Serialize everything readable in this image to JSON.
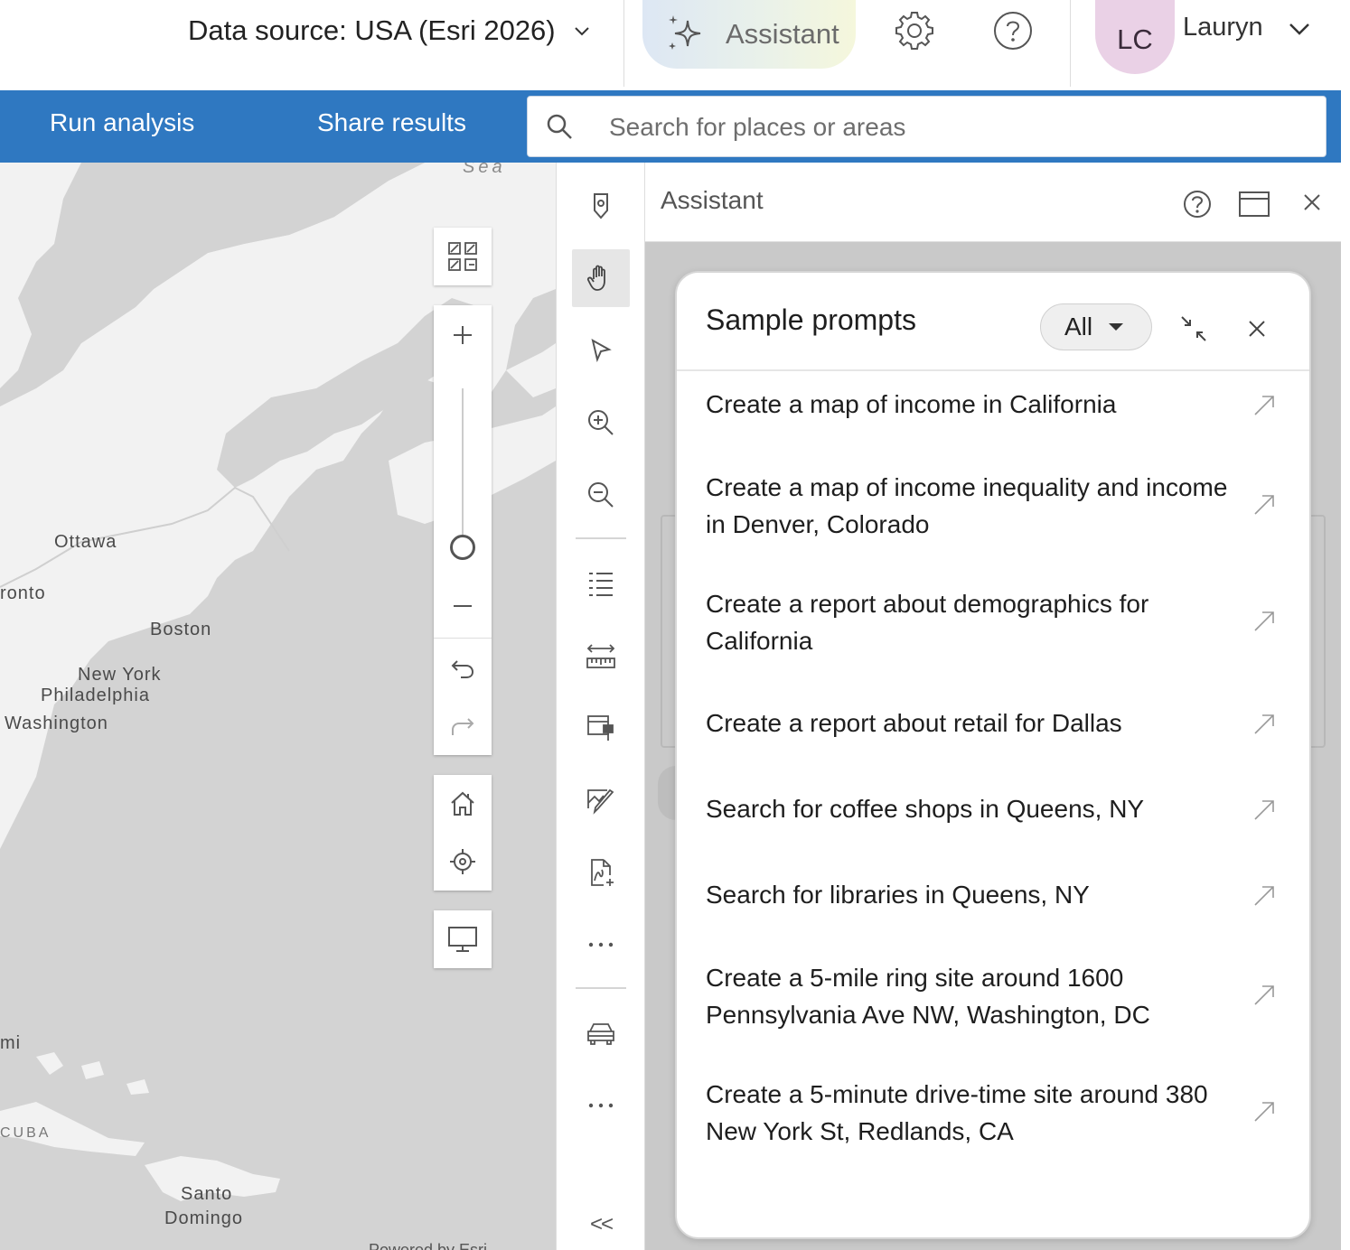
{
  "header": {
    "data_source_label": "Data source: USA (Esri 2026)",
    "assistant_label": "Assistant",
    "settings_icon": "gear-icon",
    "help_icon": "help-circle-icon",
    "user_initials": "LC",
    "user_name": "Lauryn",
    "avatar_color": "#ead1e6"
  },
  "actionbar": {
    "run_analysis": "Run analysis",
    "share_results": "Share results",
    "search_placeholder": "Search for places or areas",
    "search_value": "",
    "bar_color": "#2f78c1"
  },
  "map": {
    "places": {
      "sea": "Sea",
      "ottawa": "Ottawa",
      "toronto": "ronto",
      "boston": "Boston",
      "new_york": "New York",
      "philadelphia": "Philadelphia",
      "washington": "Washington",
      "miami": "mi",
      "cuba": "CUBA",
      "santo": "Santo",
      "domingo": "Domingo"
    },
    "attribution": "Powered by Esri",
    "zoom_level_fraction": 0.2
  },
  "toolbar": {
    "items": [
      "pin-icon",
      "pan-hand-icon",
      "select-arrow-icon",
      "zoom-in-icon",
      "zoom-out-icon",
      "list-icon",
      "measure-icon",
      "map-report-icon",
      "sketch-icon",
      "add-file-icon",
      "more-icon",
      "drive-time-car-icon",
      "more-icon"
    ],
    "active": "pan-hand-icon",
    "collapse_label": "<<"
  },
  "panel": {
    "title": "Assistant",
    "modal": {
      "title": "Sample prompts",
      "filter_value": "All",
      "prompts": [
        "Create a map of income in California",
        "Create a map of income inequality and income in Denver, Colorado",
        "Create a report about demographics for California",
        "Create a report about retail for Dallas",
        "Search for coffee shops in Queens, NY",
        "Search for libraries in Queens, NY",
        "Create a 5-mile ring site around 1600 Pennsylvania Ave NW, Washington, DC",
        "Create a 5-minute drive-time site around 380 New York St, Redlands, CA"
      ]
    }
  }
}
